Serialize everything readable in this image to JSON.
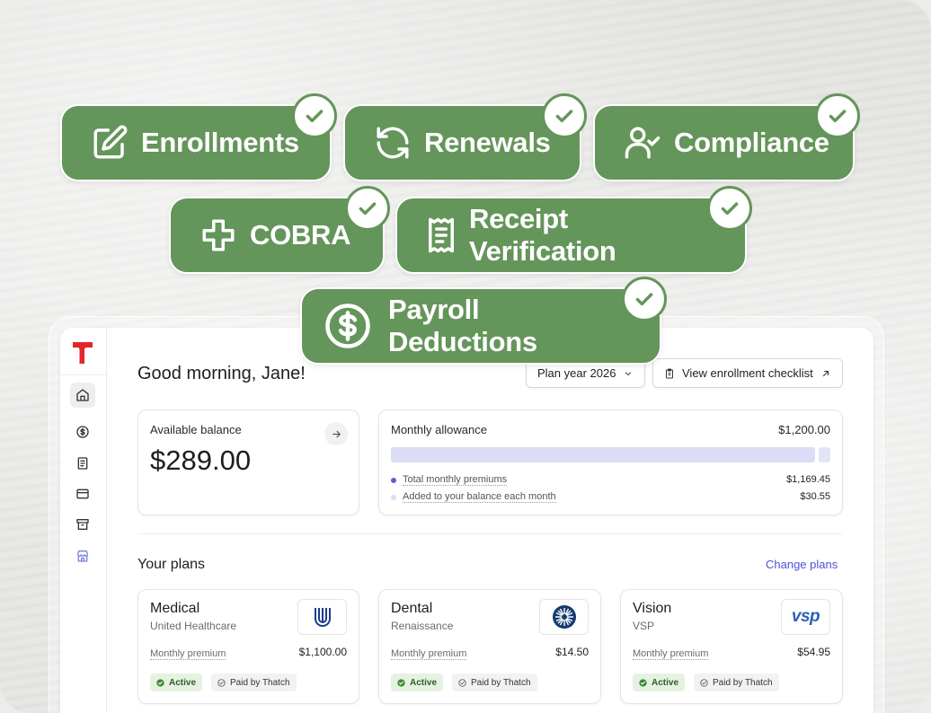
{
  "features": [
    {
      "label": "Enrollments",
      "icon": "edit-icon"
    },
    {
      "label": "Renewals",
      "icon": "refresh-icon"
    },
    {
      "label": "Compliance",
      "icon": "user-check-icon"
    },
    {
      "label": "COBRA",
      "icon": "plus-icon"
    },
    {
      "label": "Receipt Verification",
      "icon": "receipt-icon"
    },
    {
      "label": "Payroll Deductions",
      "icon": "dollar-circle-icon"
    }
  ],
  "colors": {
    "accent_green": "#64955a",
    "brand_red": "#e3262b",
    "link_blue": "#4c52d6",
    "bar_premiums": "#5a5fd8",
    "bar_added": "#dcdcf6"
  },
  "app": {
    "greeting": "Good morning, Jane!",
    "plan_year_button": "Plan year 2026",
    "checklist_button": "View enrollment checklist",
    "balance": {
      "label": "Available balance",
      "value": "$289.00"
    },
    "allowance": {
      "label": "Monthly allowance",
      "total": "$1,200.00",
      "premium_fraction": 0.974,
      "rows": [
        {
          "label": "Total monthly premiums",
          "value": "$1,169.45"
        },
        {
          "label": "Added to your balance each month",
          "value": "$30.55"
        }
      ]
    },
    "plans_section": {
      "title": "Your plans",
      "change_link": "Change plans"
    },
    "plans": [
      {
        "name": "Medical",
        "carrier": "United Healthcare",
        "premium_label": "Monthly premium",
        "premium": "$1,100.00",
        "status": "Active",
        "paid": "Paid by Thatch"
      },
      {
        "name": "Dental",
        "carrier": "Renaissance",
        "premium_label": "Monthly premium",
        "premium": "$14.50",
        "status": "Active",
        "paid": "Paid by Thatch"
      },
      {
        "name": "Vision",
        "carrier": "VSP",
        "premium_label": "Monthly premium",
        "premium": "$54.95",
        "status": "Active",
        "paid": "Paid by Thatch",
        "logo_text": "vsp"
      }
    ]
  }
}
